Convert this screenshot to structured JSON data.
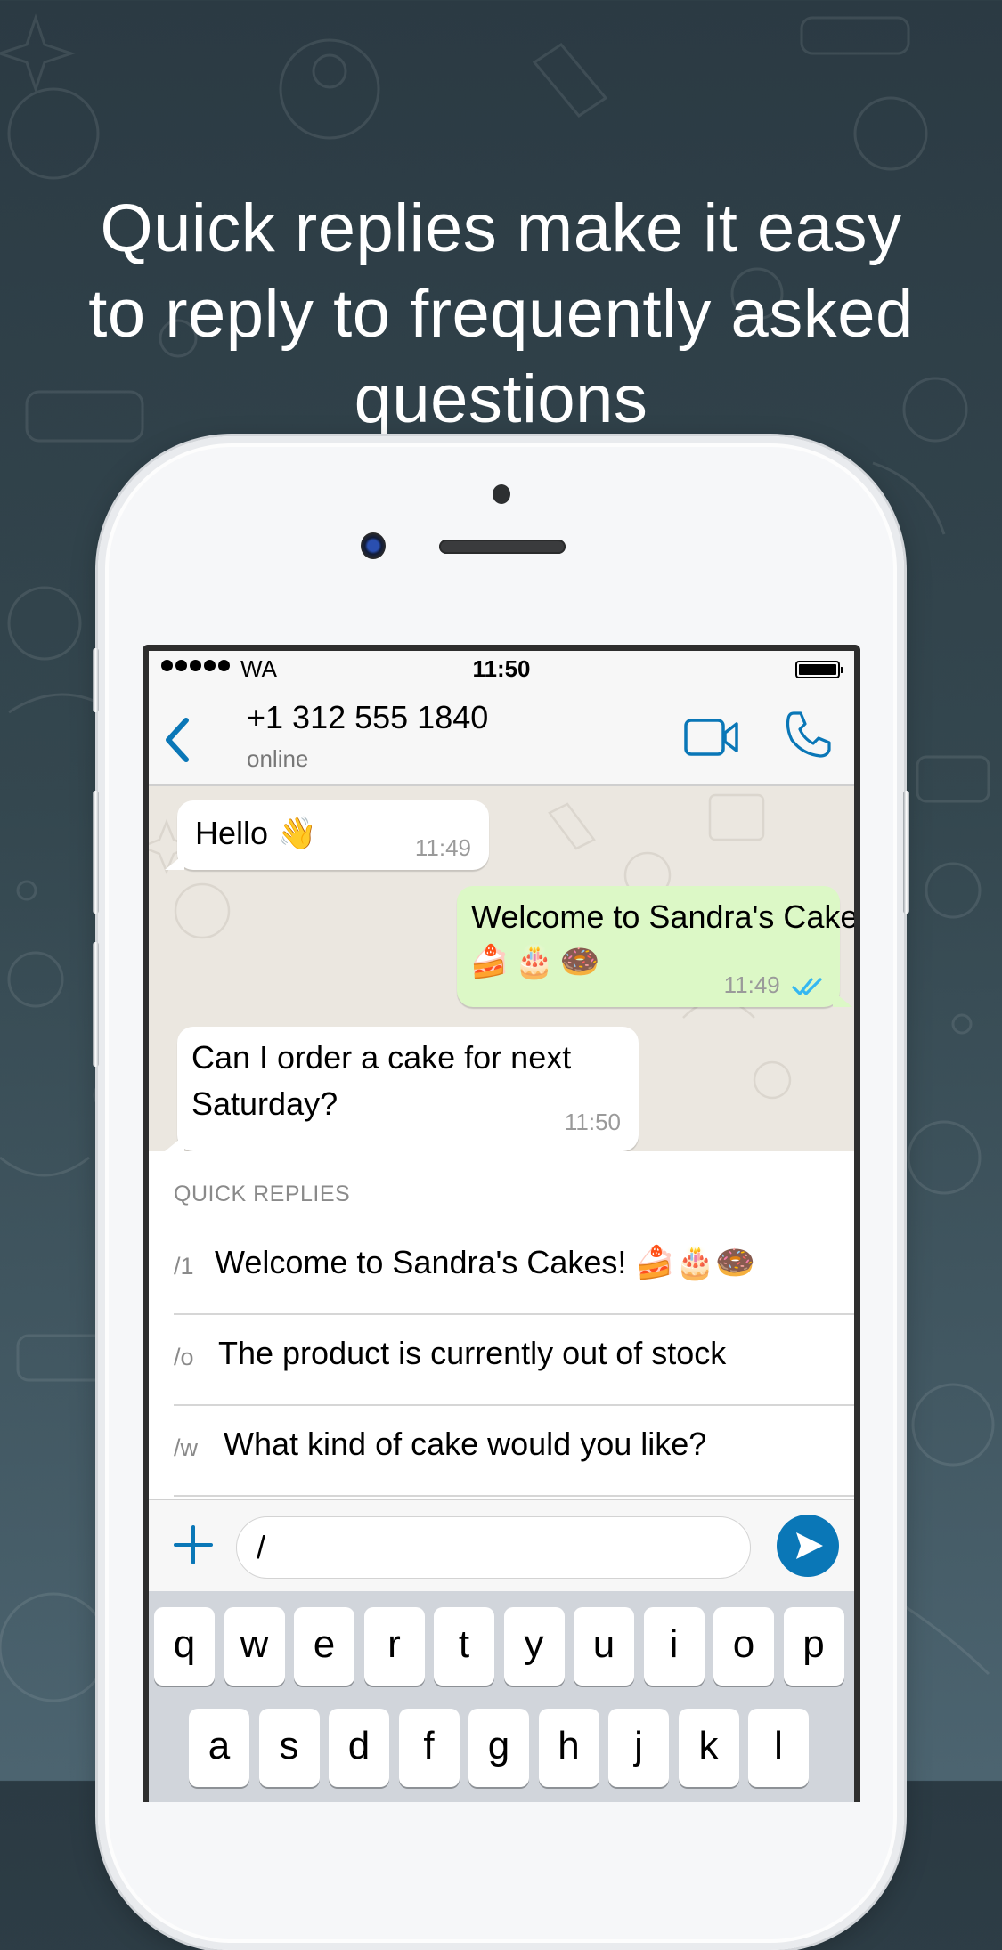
{
  "headline": {
    "lines": [
      "Quick replies make it easy",
      "to reply to frequently asked",
      "questions"
    ]
  },
  "status_bar": {
    "carrier": "WA",
    "time": "11:50",
    "signal_bars": 5,
    "battery_level": 1.0
  },
  "chat_header": {
    "contact_name": "+1 312 555 1840",
    "contact_status": "online",
    "back_icon": "chevron-left-icon",
    "video_icon": "video-camera-icon",
    "call_icon": "phone-icon",
    "accent_color": "#0a77b7"
  },
  "messages": [
    {
      "direction": "incoming",
      "text": "Hello 👋",
      "time": "11:49"
    },
    {
      "direction": "outgoing",
      "text": "Welcome to Sandra's Cakes!",
      "text2": "🍰🎂🍩",
      "time": "11:49",
      "status": "read",
      "tick_color": "#34b7f1"
    },
    {
      "direction": "incoming",
      "text": "Can I order a cake for next",
      "text2": "Saturday?",
      "time": "11:50"
    }
  ],
  "quick_replies": {
    "header": "QUICK REPLIES",
    "items": [
      {
        "shortcut": "/1",
        "text": "Welcome to Sandra's Cakes! 🍰🎂🍩"
      },
      {
        "shortcut": "/o",
        "text": "The product is currently out of stock"
      },
      {
        "shortcut": "/w",
        "text": "What kind of cake would you like?"
      }
    ]
  },
  "composer": {
    "value": "/",
    "plus_icon": "plus-icon",
    "send_icon": "send-icon"
  },
  "keyboard": {
    "row1": [
      "q",
      "w",
      "e",
      "r",
      "t",
      "y",
      "u",
      "i",
      "o",
      "p"
    ],
    "row2": [
      "a",
      "s",
      "d",
      "f",
      "g",
      "h",
      "j",
      "k",
      "l"
    ]
  }
}
